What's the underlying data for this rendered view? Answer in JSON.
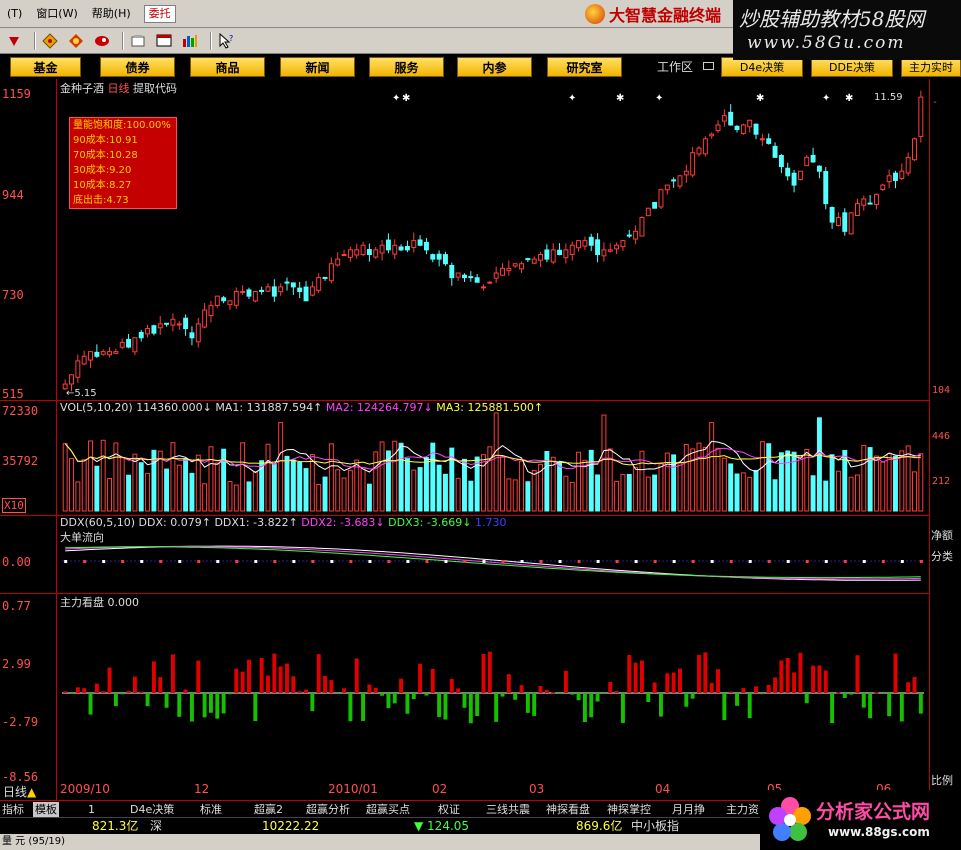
{
  "menu": {
    "items": [
      "(T)",
      "窗口(W)",
      "帮助(H)"
    ],
    "entrust": "委托"
  },
  "brand": {
    "text": "大智慧金融终端"
  },
  "watermark_top": {
    "line1": "炒股辅助教材58股网",
    "line2": "www.58Gu.com"
  },
  "toolbar": {
    "icons": [
      "down-arrow-icon",
      "diamond-icon",
      "flame-icon",
      "red-bird-icon",
      "tool-icon",
      "monitor-icon",
      "window-icon",
      "chart-icon",
      "help-cursor-icon"
    ]
  },
  "nav": {
    "buttons": [
      "基金",
      "债券",
      "商品",
      "新闻",
      "服务",
      "内参",
      "研究室"
    ],
    "workzone": "工作区",
    "right_buttons": [
      "D4e决策",
      "DDE决策",
      "主力实时"
    ]
  },
  "kline": {
    "stock_name": "金种子酒",
    "period": "日线",
    "extract": "提取代码",
    "price_labels": [
      "1159",
      "944",
      "730",
      "515"
    ],
    "high_label": "11.59",
    "low_label": "5.15",
    "cost_lines": [
      "量能饱和度:100.00%",
      "90成本:10.91",
      "70成本:10.28",
      "30成本:9.20",
      "10成本:8.27",
      "底出击:4.73"
    ],
    "right_labels": [
      "-",
      "104"
    ]
  },
  "vol": {
    "title": "VOL(5,10,20)",
    "values": [
      "114360.000↓",
      "MA1: 131887.594↑",
      "MA2: 124264.797↓",
      "MA3: 125881.500↑"
    ],
    "axis": [
      "72330",
      "35792",
      "X10"
    ],
    "right_labels": [
      "446",
      "212"
    ]
  },
  "ddx": {
    "title": "DDX(60,5,10)",
    "values": [
      "DDX: 0.079↑",
      "DDX1: -3.822↑",
      "DDX2: -3.683↓",
      "DDX3: -3.669↓",
      "1.730"
    ],
    "sub": "大单流向",
    "axis": [
      "0.00"
    ],
    "right_labels": [
      "净额",
      "分类"
    ]
  },
  "main_force": {
    "title": "主力看盘",
    "value": "0.000",
    "axis": [
      "0.77",
      "2.99",
      "-2.79",
      "-8.56"
    ],
    "right_labels": [
      "比例"
    ]
  },
  "x_dates": [
    "2009/10",
    "12",
    "2010/01",
    "02",
    "03",
    "04",
    "05",
    "06"
  ],
  "bottom_tabs": [
    "指标",
    "模板",
    "1",
    "D4e决策",
    "标准",
    "超赢2",
    "超赢分析",
    "超赢买点",
    "权证",
    "三线共震",
    "神探看盘",
    "神探掌控",
    "月月挣",
    "主力资"
  ],
  "period_tab": "日线",
  "status": {
    "amount1": "821.3亿",
    "market1": "深",
    "index": "10222.22",
    "change": "▼ 124.05",
    "amount2": "869.6亿",
    "market2": "中小板指"
  },
  "bottom_strip": "量 元 (95/19)",
  "watermark_bottom": {
    "title": "分析家公式网",
    "url": "www.88gs.com"
  },
  "colors": {
    "up": "#ff3c3c",
    "down": "#54ffff",
    "green": "#16c000",
    "border": "#c00000",
    "nav_yellow": "#f2b300"
  },
  "chart_data": {
    "type": "candlestick",
    "price_range": [
      5.15,
      11.59
    ],
    "closes": [
      5.3,
      5.5,
      5.8,
      5.9,
      6.0,
      5.9,
      6.0,
      6.0,
      6.0,
      6.2,
      6.1,
      6.3,
      6.3,
      6.5,
      6.4,
      6.6,
      6.6,
      6.7,
      6.6,
      6.5,
      6.3,
      6.6,
      6.9,
      7.0,
      7.2,
      7.1,
      7.1,
      7.3,
      7.3,
      7.2,
      7.3,
      7.3,
      7.4,
      7.2,
      7.4,
      7.5,
      7.4,
      7.3,
      7.1,
      7.4,
      7.6,
      7.6,
      7.9,
      8.0,
      8.1,
      8.2,
      8.2,
      8.3,
      8.1,
      8.2,
      8.3,
      8.2,
      8.3,
      8.2,
      8.2,
      8.4,
      8.3,
      8.2,
      8.0,
      8.0,
      7.9,
      7.6,
      7.7,
      7.6,
      7.6,
      7.5,
      7.4,
      7.5,
      7.7,
      7.8,
      7.8,
      7.9,
      7.9,
      8.0,
      8.0,
      8.1,
      8.0,
      8.2,
      8.1,
      8.2,
      8.3,
      8.4,
      8.4,
      8.3,
      8.1,
      8.2,
      8.2,
      8.3,
      8.4,
      8.5,
      8.6,
      8.9,
      9.1,
      9.1,
      9.5,
      9.6,
      9.7,
      9.8,
      9.9,
      10.3,
      10.4,
      10.6,
      10.7,
      10.9,
      11.1,
      10.9,
      10.8,
      10.9,
      11.0,
      10.7,
      10.6,
      10.5,
      10.2,
      10.0,
      9.8,
      9.6,
      9.9,
      10.2,
      10.1,
      9.9,
      9.2,
      8.8,
      8.9,
      8.6,
      9.0,
      9.2,
      9.3,
      9.2,
      9.4,
      9.6,
      9.8,
      9.7,
      9.9,
      10.2,
      10.6,
      11.5
    ],
    "volume_max": 72330,
    "main_force_range": [
      -8.56,
      0.77
    ]
  }
}
